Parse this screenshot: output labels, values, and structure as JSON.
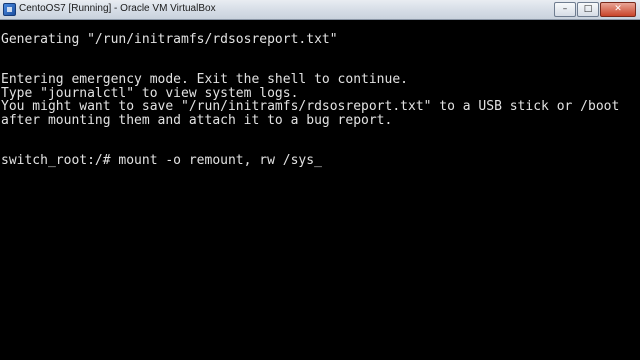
{
  "window": {
    "title": "CentoOS7 [Running] - Oracle VM VirtualBox",
    "controls": {
      "minimize": "–",
      "maximize": "□",
      "close": "✕"
    }
  },
  "console": {
    "lines": [
      "Generating \"/run/initramfs/rdsosreport.txt\"",
      "Entering emergency mode. Exit the shell to continue.",
      "Type \"journalctl\" to view system logs.",
      "You might want to save \"/run/initramfs/rdsosreport.txt\" to a USB stick or /boot",
      "after mounting them and attach it to a bug report.",
      "switch_root:/# mount -o remount, rw /sys"
    ],
    "cursor": "_"
  }
}
